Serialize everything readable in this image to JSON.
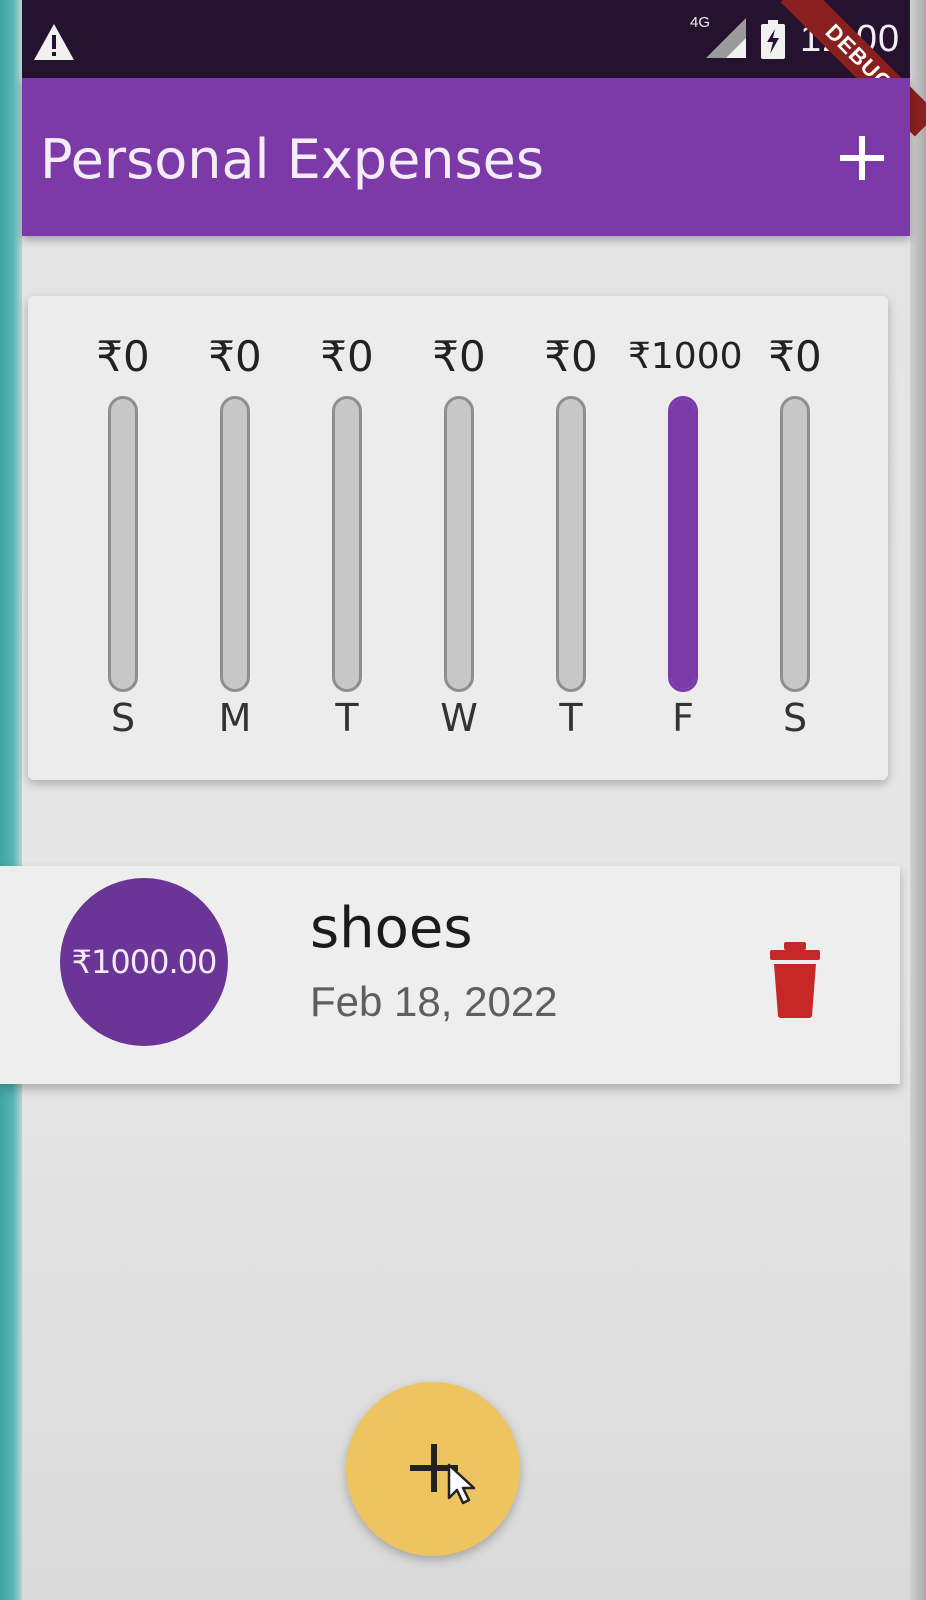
{
  "status_bar": {
    "time": "12:00",
    "network": "4G",
    "debug_label": "DEBUG",
    "icons": [
      "warning-icon",
      "signal-icon",
      "battery-charging-icon"
    ]
  },
  "app_bar": {
    "title": "Personal Expenses",
    "action_icon": "plus-icon"
  },
  "chart_data": {
    "type": "bar",
    "categories": [
      "S",
      "M",
      "T",
      "W",
      "T",
      "F",
      "S"
    ],
    "values": [
      0,
      0,
      0,
      0,
      0,
      1000,
      0
    ],
    "value_labels": [
      "₹0",
      "₹0",
      "₹0",
      "₹0",
      "₹0",
      "₹1000",
      "₹0"
    ],
    "bar_fill_fraction": [
      0,
      0,
      0,
      0,
      0,
      1.0,
      0
    ],
    "fill_color": "#7b3aa7",
    "track_color": "#c8c8c8"
  },
  "transactions": [
    {
      "amount": "₹1000.00",
      "title": "shoes",
      "date": "Feb 18, 2022",
      "delete_icon": "trash-icon"
    }
  ],
  "fab": {
    "icon": "plus-icon"
  },
  "colors": {
    "primary": "#7b3aa7",
    "accent": "#edc45f",
    "delete": "#c62828"
  }
}
